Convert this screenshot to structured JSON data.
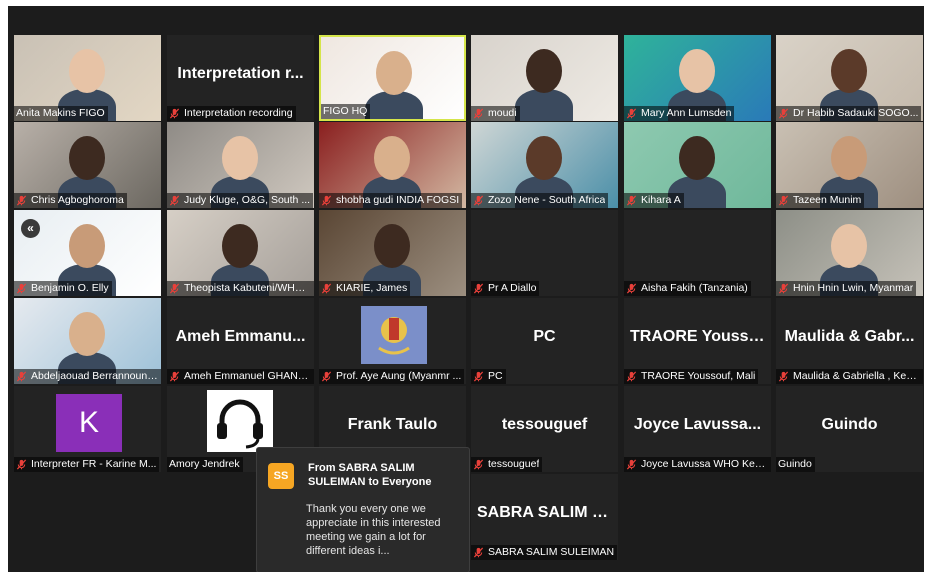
{
  "participants": [
    {
      "name": "Anita Makins FIGO",
      "display_name": "",
      "muted": false
    },
    {
      "name": "Interpretation recording",
      "display_name": "Interpretation r...",
      "muted": true
    },
    {
      "name": "FIGO HQ",
      "display_name": "",
      "muted": false,
      "active_speaker": true
    },
    {
      "name": "moudi",
      "display_name": "",
      "muted": true
    },
    {
      "name": "Mary Ann Lumsden",
      "display_name": "",
      "muted": true
    },
    {
      "name": "Dr Habib Sadauki SOGO...",
      "display_name": "",
      "muted": true
    },
    {
      "name": "Chris Agboghoroma",
      "display_name": "",
      "muted": true
    },
    {
      "name": "Judy Kluge, O&G, South ...",
      "display_name": "",
      "muted": true
    },
    {
      "name": "shobha gudi INDIA FOGSI",
      "display_name": "",
      "muted": true
    },
    {
      "name": "Zozo Nene - South Africa",
      "display_name": "",
      "muted": true
    },
    {
      "name": "Kihara A",
      "display_name": "",
      "muted": true
    },
    {
      "name": "Tazeen Munim",
      "display_name": "",
      "muted": true
    },
    {
      "name": "Benjamin O. Elly",
      "display_name": "",
      "muted": true
    },
    {
      "name": "Theopista Kabuteni/WHO...",
      "display_name": "",
      "muted": true
    },
    {
      "name": "KIARIE, James",
      "display_name": "",
      "muted": true
    },
    {
      "name": "Pr A Diallo",
      "display_name": "",
      "muted": true
    },
    {
      "name": "Aisha Fakih (Tanzania)",
      "display_name": "",
      "muted": true
    },
    {
      "name": "Hnin Hnin Lwin, Myanmar",
      "display_name": "",
      "muted": true
    },
    {
      "name": "Abdeljaouad Berrannoun ...",
      "display_name": "",
      "muted": true
    },
    {
      "name": "Ameh Emmanuel GHANA...",
      "display_name": "Ameh Emmanu...",
      "muted": true
    },
    {
      "name": "Prof. Aye Aung (Myanmr ...",
      "display_name": "",
      "muted": true
    },
    {
      "name": "PC",
      "display_name": "PC",
      "muted": true
    },
    {
      "name": "TRAORE Youssouf, Mali",
      "display_name": "TRAORE Yousso...",
      "muted": true
    },
    {
      "name": "Maulida & Gabriella , Ken...",
      "display_name": "Maulida & Gabr...",
      "muted": true
    },
    {
      "name": "Interpreter FR - Karine M...",
      "display_name": "",
      "avatar_letter": "K",
      "muted": true
    },
    {
      "name": "Amory Jendrek",
      "display_name": "",
      "muted": false
    },
    {
      "name": "",
      "display_name": "Frank Taulo",
      "muted": false
    },
    {
      "name": "tessouguef",
      "display_name": "tessouguef",
      "muted": true
    },
    {
      "name": "Joyce Lavussa WHO Kenya",
      "display_name": "Joyce Lavussa...",
      "muted": true
    },
    {
      "name": "Guindo",
      "display_name": "Guindo",
      "muted": false
    },
    {
      "name": "SABRA SALIM SULEIMAN",
      "display_name": "SABRA SALIM S...",
      "muted": true
    }
  ],
  "collapse_glyph": "«",
  "chat": {
    "avatar_initials": "SS",
    "sender": "From SABRA SALIM SULEIMAN to Everyone",
    "message": "Thank you every one we appreciate in this interested meeting we gain a lot for different ideas i...",
    "avatar_color": "#f6a623"
  },
  "colors": {
    "background": "#1c1c1c",
    "tile": "#232323",
    "active_speaker_border": "#d5e54a",
    "muted_icon": "#e8403a"
  }
}
